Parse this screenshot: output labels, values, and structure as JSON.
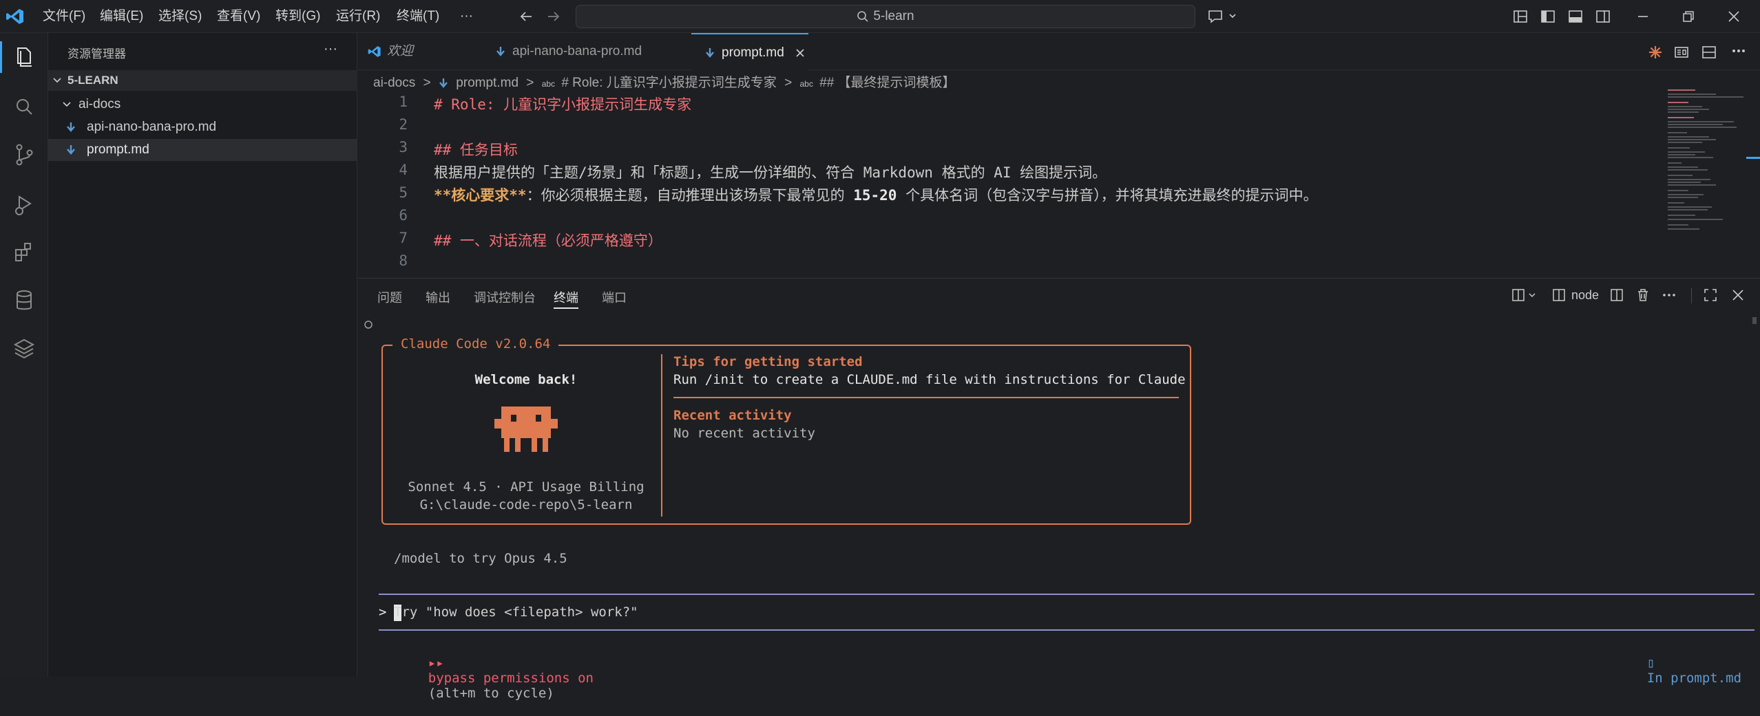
{
  "titlebar": {
    "menus": [
      "文件(F)",
      "编辑(E)",
      "选择(S)",
      "查看(V)",
      "转到(G)",
      "运行(R)",
      "终端(T)"
    ],
    "more": "···",
    "search_text": "5-learn"
  },
  "sidebar": {
    "title": "资源管理器",
    "more": "···",
    "root": "5-LEARN",
    "folder": "ai-docs",
    "files": [
      "api-nano-bana-pro.md",
      "prompt.md"
    ]
  },
  "tabs": [
    {
      "label": "欢迎",
      "italic": true
    },
    {
      "label": "api-nano-bana-pro.md"
    },
    {
      "label": "prompt.md",
      "active": true
    }
  ],
  "breadcrumb": {
    "parts": [
      "ai-docs",
      "prompt.md",
      "# Role: 儿童识字小报提示词生成专家",
      "## 【最终提示词模板】"
    ],
    "sep": ">"
  },
  "editor": {
    "lines": [
      {
        "n": "1",
        "segments": [
          {
            "t": "# Role: 儿童识字小报提示词生成专家",
            "c": "md-h"
          }
        ]
      },
      {
        "n": "2",
        "segments": []
      },
      {
        "n": "3",
        "segments": [
          {
            "t": "## 任务目标",
            "c": "md-h"
          }
        ]
      },
      {
        "n": "4",
        "segments": [
          {
            "t": "根据用户提供的「主题/场景」和「标题」，生成一份详细的、符合 Markdown 格式的 AI 绘图提示词。",
            "c": ""
          }
        ]
      },
      {
        "n": "5",
        "segments": [
          {
            "t": "**核心要求**",
            "c": "md-bold"
          },
          {
            "t": "：你必须根据主题，自动推理出该场景下最常见的 ",
            "c": ""
          },
          {
            "t": "15-20",
            "c": "md-bold2"
          },
          {
            "t": " 个具体名词（包含汉字与拼音），并将其填充进最终的提示词中。",
            "c": ""
          }
        ]
      },
      {
        "n": "6",
        "segments": []
      },
      {
        "n": "7",
        "segments": [
          {
            "t": "## 一、对话流程（必须严格遵守）",
            "c": "md-h"
          }
        ]
      },
      {
        "n": "8",
        "segments": []
      }
    ]
  },
  "panel": {
    "tabs": [
      "问题",
      "输出",
      "调试控制台",
      "终端",
      "端口"
    ],
    "active_tab": "终端",
    "terminal_name": "node"
  },
  "terminal": {
    "box_title": "Claude Code v2.0.64",
    "welcome": "Welcome back!",
    "model_line": "Sonnet 4.5 · API Usage Billing",
    "path_line": "G:\\claude-code-repo\\5-learn",
    "tips_title": "Tips for getting started",
    "tips_text": "Run /init to create a CLAUDE.md file with instructions for Claude",
    "recent_title": "Recent activity",
    "recent_text": "No recent activity",
    "hint": "/model to try Opus 4.5",
    "prompt_symbol": ">",
    "input_placeholder": "Try \"how does <filepath> work?\"",
    "bypass_symbol": "▸▸",
    "bypass_text": "bypass permissions on",
    "bypass_hint": "(alt+m to cycle)",
    "context_text": "In prompt.md",
    "accent_color": "#e07a50"
  }
}
